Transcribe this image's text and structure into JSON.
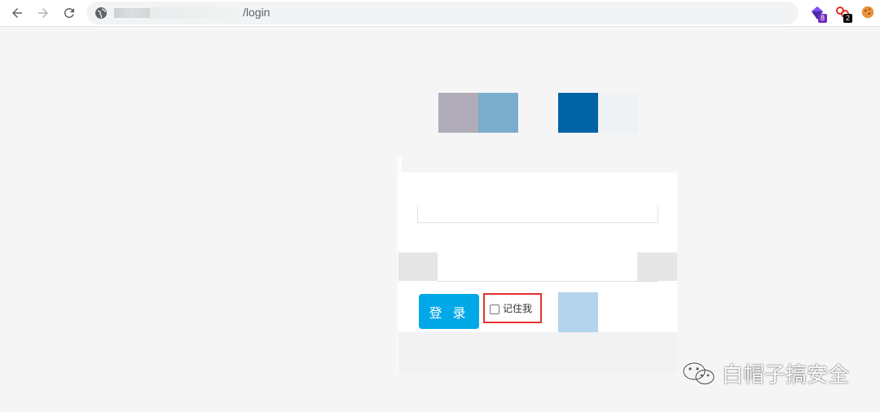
{
  "browser": {
    "url_text": "/login",
    "back_label": "Back",
    "forward_label": "Forward",
    "reload_label": "Reload",
    "extensions": [
      {
        "icon": "gem-icon",
        "badge": "8",
        "badge_color": "#6f2dbd"
      },
      {
        "icon": "chain-icon",
        "badge": "2",
        "badge_color": "#000000"
      },
      {
        "icon": "cookie-icon",
        "badge": ""
      }
    ]
  },
  "colors": {
    "block_grey": "#b0acb8",
    "block_steel": "#7aaccc",
    "block_navy": "#0063a5",
    "block_pale": "#eef2f5",
    "login_button": "#00a8e8",
    "highlight_border": "#e5312f",
    "light_blue_block": "#b3d4ec"
  },
  "form": {
    "login_button_label": "登 录",
    "remember_label": "记住我",
    "remember_checked": false
  },
  "watermark": {
    "text": "白帽子搞安全",
    "icon": "wechat-icon"
  }
}
